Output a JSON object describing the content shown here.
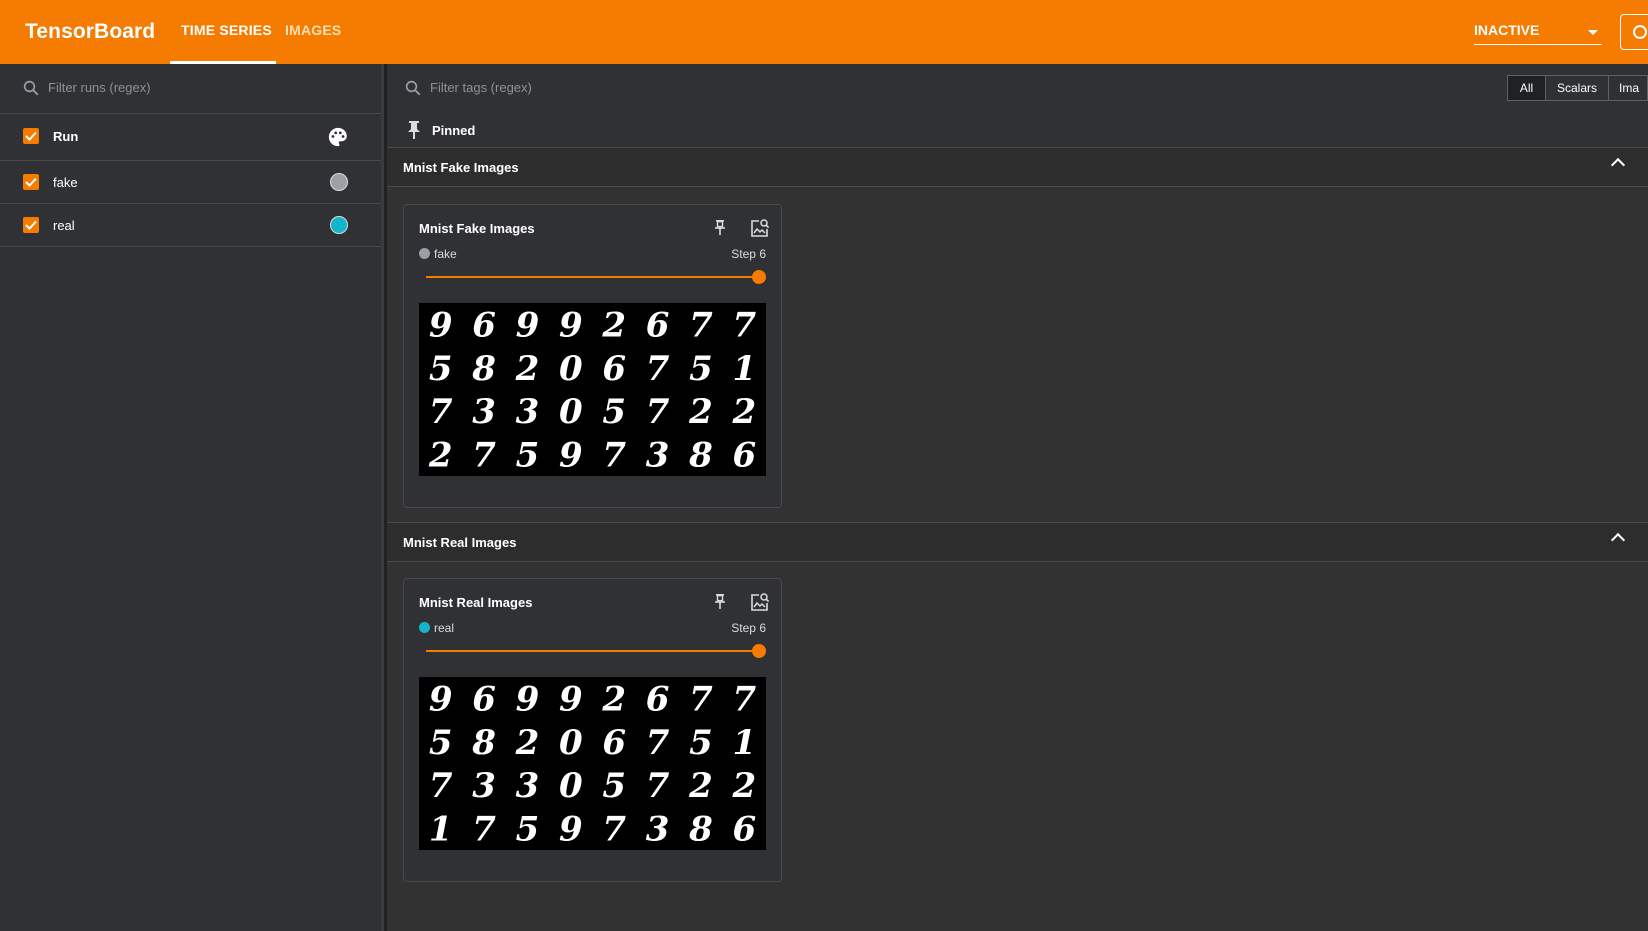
{
  "header": {
    "brand": "TensorBoard",
    "tabs": [
      {
        "label": "TIME SERIES",
        "active": true
      },
      {
        "label": "IMAGES",
        "active": false
      }
    ],
    "status_select": "INACTIVE",
    "accent_color": "#f57c00"
  },
  "sidebar": {
    "search_placeholder": "Filter runs (regex)",
    "header_label": "Run",
    "runs": [
      {
        "label": "fake",
        "color": "#9aa0a6",
        "checked": true
      },
      {
        "label": "real",
        "color": "#12b5cb",
        "checked": true
      }
    ]
  },
  "main": {
    "tag_filter_placeholder": "Filter tags (regex)",
    "type_toggles": [
      "All",
      "Scalars",
      "Ima"
    ],
    "pinned_label": "Pinned",
    "groups": [
      {
        "title": "Mnist Fake Images",
        "card": {
          "title": "Mnist Fake Images",
          "run": "fake",
          "run_color": "#9aa0a6",
          "step": "Step 6",
          "slider_value": 1.0,
          "digits": [
            [
              "9",
              "6",
              "9",
              "9",
              "2",
              "6",
              "7",
              "7"
            ],
            [
              "5",
              "8",
              "2",
              "0",
              "6",
              "7",
              "5",
              "1"
            ],
            [
              "7",
              "3",
              "3",
              "0",
              "5",
              "7",
              "2",
              "2"
            ],
            [
              "2",
              "7",
              "5",
              "9",
              "7",
              "3",
              "8",
              "6"
            ]
          ]
        }
      },
      {
        "title": "Mnist Real Images",
        "card": {
          "title": "Mnist Real Images",
          "run": "real",
          "run_color": "#12b5cb",
          "step": "Step 6",
          "slider_value": 1.0,
          "digits": [
            [
              "9",
              "6",
              "9",
              "9",
              "2",
              "6",
              "7",
              "7"
            ],
            [
              "5",
              "8",
              "2",
              "0",
              "6",
              "7",
              "5",
              "1"
            ],
            [
              "7",
              "3",
              "3",
              "0",
              "5",
              "7",
              "2",
              "2"
            ],
            [
              "1",
              "7",
              "5",
              "9",
              "7",
              "3",
              "8",
              "6"
            ]
          ]
        }
      }
    ]
  }
}
